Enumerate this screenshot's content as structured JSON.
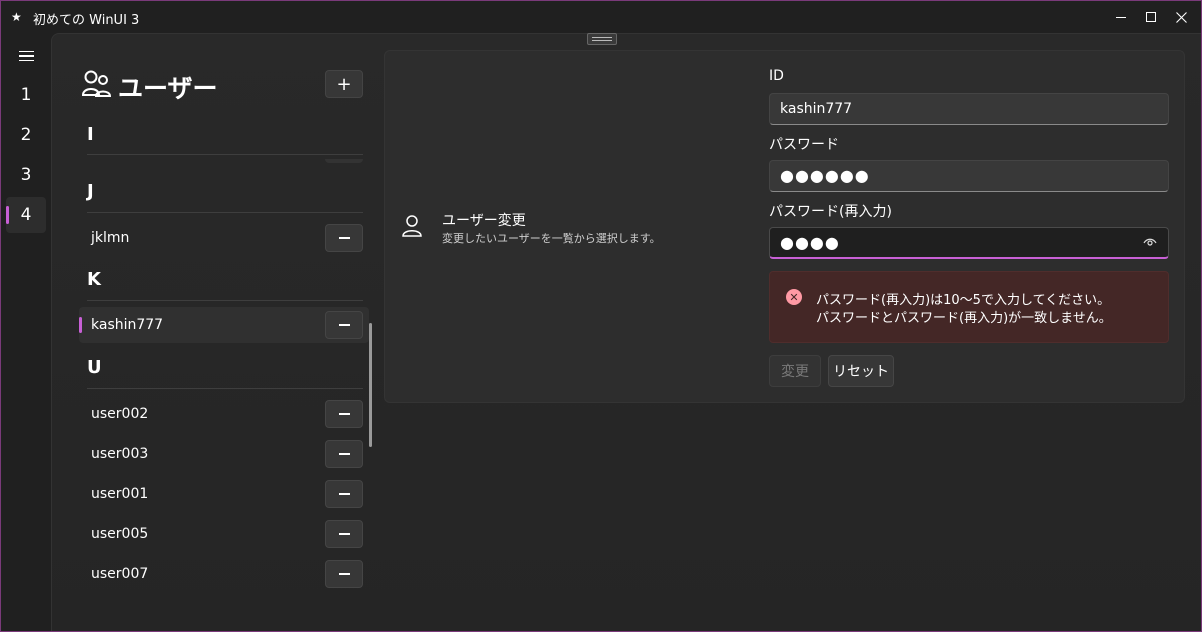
{
  "window": {
    "title": "初めての WinUI 3",
    "app_icon": "star-icon",
    "accent_color": "#c860d6"
  },
  "nav": {
    "items": [
      "1",
      "2",
      "3",
      "4"
    ],
    "selected": "4"
  },
  "list": {
    "title": "ユーザー",
    "add_label": "+",
    "groups": [
      {
        "header": "I",
        "items": []
      },
      {
        "header": "J",
        "items": [
          "jklmn"
        ]
      },
      {
        "header": "K",
        "items": [
          "kashin777"
        ]
      },
      {
        "header": "U",
        "items": [
          "user002",
          "user003",
          "user001",
          "user005",
          "user007"
        ]
      }
    ],
    "selected_item": "kashin777"
  },
  "setting": {
    "title": "ユーザー変更",
    "description": "変更したいユーザーを一覧から選択します。"
  },
  "form": {
    "id_label": "ID",
    "id_value": "kashin777",
    "password_label": "パスワード",
    "password_value": "●●●●●●",
    "password_confirm_label": "パスワード(再入力)",
    "password_confirm_value": "●●●●",
    "errors": [
      "パスワード(再入力)は10～5で入力してください。",
      "パスワードとパスワード(再入力)が一致しません。"
    ],
    "error_color": "#ff99a4",
    "change_button": "変更",
    "reset_button": "リセット"
  }
}
